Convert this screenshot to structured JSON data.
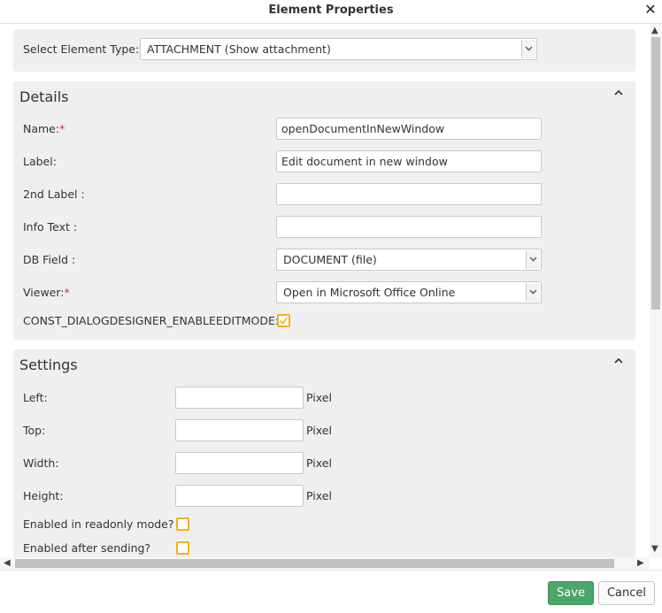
{
  "dialog": {
    "title": "Element Properties",
    "close_icon": "close-icon"
  },
  "element_type": {
    "label": "Select Element Type:",
    "value": "ATTACHMENT (Show attachment)"
  },
  "details": {
    "header": "Details",
    "name": {
      "label": "Name:",
      "required": "*",
      "value": "openDocumentInNewWindow"
    },
    "label_field": {
      "label": "Label:",
      "value": "Edit document in new window"
    },
    "second_label": {
      "label": "2nd Label :",
      "value": ""
    },
    "info_text": {
      "label": "Info Text :",
      "value": ""
    },
    "db_field": {
      "label": "DB Field :",
      "value": "DOCUMENT (file)"
    },
    "viewer": {
      "label": "Viewer:",
      "required": "*",
      "value": "Open in Microsoft Office Online"
    },
    "edit_mode": {
      "label": "CONST_DIALOGDESIGNER_ENABLEEDITMODE:",
      "checked": true
    }
  },
  "settings": {
    "header": "Settings",
    "unit": "Pixel",
    "left": {
      "label": "Left:",
      "value": ""
    },
    "top": {
      "label": "Top:",
      "value": ""
    },
    "width": {
      "label": "Width:",
      "value": ""
    },
    "height": {
      "label": "Height:",
      "value": ""
    },
    "readonly_mode": {
      "label": "Enabled in readonly mode?",
      "checked": false
    },
    "after_sending": {
      "label": "Enabled after sending?",
      "checked": false
    }
  },
  "footer": {
    "save_label": "Save",
    "cancel_label": "Cancel"
  },
  "colors": {
    "save": "#4ca56a",
    "checkbox_border": "#f2b21f",
    "required": "#d03030",
    "panel_bg": "#efefef"
  }
}
